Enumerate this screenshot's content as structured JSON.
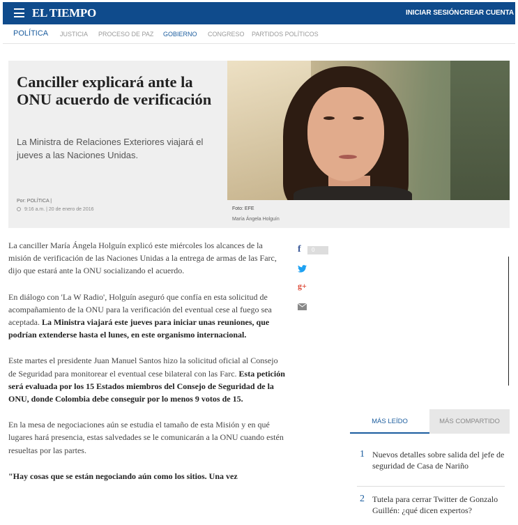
{
  "header": {
    "logo": "EL TIEMPO",
    "login": "INICIAR SESIÓN",
    "signup": "CREAR CUENTA",
    "brand_color": "#0f4b8c"
  },
  "nav": {
    "items": [
      "POLÍTICA",
      "JUSTICIA",
      "PROCESO DE PAZ",
      "GOBIERNO",
      "CONGRESO",
      "PARTIDOS POLÍTICOS"
    ]
  },
  "article": {
    "headline": "Canciller explicará ante la ONU acuerdo de verificación",
    "deck": "La Ministra de Relaciones Exteriores viajará el jueves a las Naciones Unidas.",
    "byline": "Por: POLÍTICA |",
    "date": "9:16 a.m. | 20 de enero de 2016",
    "photo_credit": "Foto: EFE",
    "photo_caption": "María Ángela Holguín",
    "p1": "La canciller María Ángela Holguín explicó este miércoles los alcances de la misión de verificación de las Naciones Unidas a la entrega de armas de las Farc, dijo que estará ante la ONU socializando el acuerdo.",
    "p2a": "En diálogo con 'La W Radio', Holguín aseguró que confía en esta solicitud de acompañamiento de la ONU para la verificación del eventual cese al fuego sea aceptada.",
    "p2b": "La Ministra viajará este jueves para iniciar unas reuniones, que podrían extenderse hasta el lunes, en este organismo internacional.",
    "p3a": "Este martes el presidente Juan Manuel Santos hizo la solicitud oficial al Consejo de Seguridad para monitorear el eventual cese bilateral con las Farc.",
    "p3b": "Esta petición será evaluada por los 15 Estados miembros del Consejo de Seguridad de la ONU, donde Colombia debe conseguir por lo menos 9 votos de 15.",
    "p4": "En la mesa de negociaciones aún se estudia el tamaño de esta Misión y en qué lugares hará presencia, estas salvedades se le comunicarán a la ONU cuando estén resueltas por las partes.",
    "p5": "\"Hay cosas que se están negociando aún como los sitios. Una vez"
  },
  "share": {
    "fb_icon": "f",
    "fb_count": "0",
    "gp_icon": "g+"
  },
  "most_read": {
    "tab_active": "MÁS LEÍDO",
    "tab_inactive": "MÁS COMPARTIDO",
    "items": [
      {
        "num": "1",
        "text": "Nuevos detalles sobre salida del jefe de seguridad de Casa de Nariño"
      },
      {
        "num": "2",
        "text": "Tutela para cerrar Twitter de Gonzalo Guillén: ¿qué dicen expertos?"
      }
    ]
  }
}
